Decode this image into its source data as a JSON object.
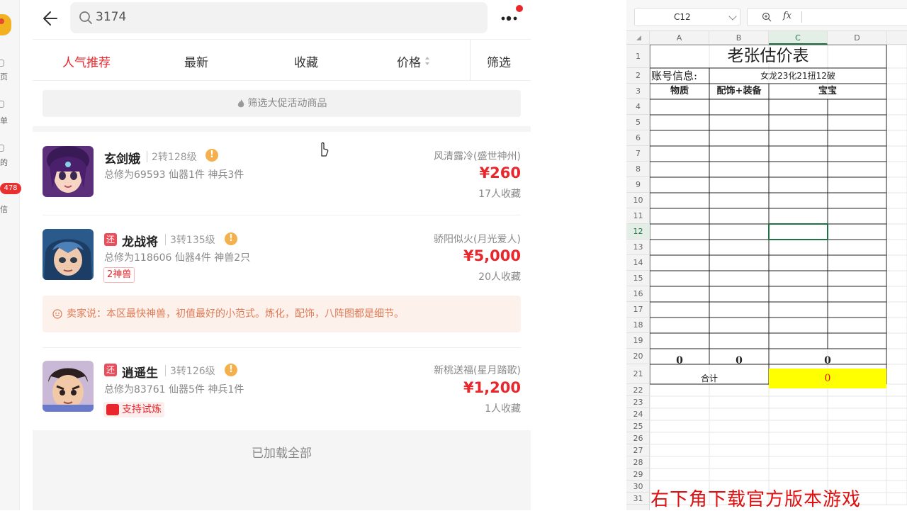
{
  "left_strip": {
    "labels": [
      "页",
      "单",
      "的",
      "信"
    ],
    "badge": "478"
  },
  "app": {
    "search": {
      "value": "3174"
    },
    "tabs": [
      "人气推荐",
      "最新",
      "收藏",
      "价格",
      "筛选"
    ],
    "promo_label": "筛选大促活动商品",
    "items": [
      {
        "name": "玄剑娥",
        "level": "2转128级",
        "attrs": "总修为69593  仙器1件  神兵3件",
        "server": "风清露冷(盛世神州)",
        "price": "¥260",
        "favs": "17人收藏"
      },
      {
        "badge": "还",
        "name": "龙战将",
        "level": "3转135级",
        "attrs": "总修为118606  仙器4件  神兽2只",
        "tag": "2神兽",
        "server": "骄阳似火(月光爱人)",
        "price": "¥5,000",
        "favs": "20人收藏",
        "seller_note": "卖家说：本区最快神兽，初值最好的小范式。炼化，配饰，八阵图都是细节。"
      },
      {
        "badge": "还",
        "name": "逍遥生",
        "level": "3转126级",
        "attrs": "总修为83761  仙器5件  神兵1件",
        "tag": "支持试炼",
        "server": "新桃送福(星月踏歌)",
        "price": "¥1,200",
        "favs": "1人收藏"
      }
    ],
    "all_loaded": "已加载全部"
  },
  "sheet": {
    "namebox": "C12",
    "fx": "fx",
    "columns": [
      "A",
      "B",
      "C",
      "D"
    ],
    "rows": [
      "1",
      "2",
      "3",
      "4",
      "5",
      "6",
      "7",
      "8",
      "9",
      "10",
      "11",
      "12",
      "13",
      "14",
      "15",
      "16",
      "17",
      "18",
      "19",
      "20",
      "21",
      "22",
      "23",
      "24",
      "25",
      "26",
      "27",
      "28",
      "29",
      "30",
      "31"
    ],
    "title": "老张估价表",
    "account_label": "账号信息:",
    "account_value": "女龙23化21扭12破",
    "headers": [
      "物质",
      "配饰+装备",
      "宝宝"
    ],
    "totals": [
      "0",
      "0",
      "0"
    ],
    "sum_label": "合计",
    "sum_value": "0",
    "colors": {
      "sum_fill": "#ffff00",
      "selected": "#217346"
    }
  },
  "watermark": "右下角下载官方版本游戏"
}
